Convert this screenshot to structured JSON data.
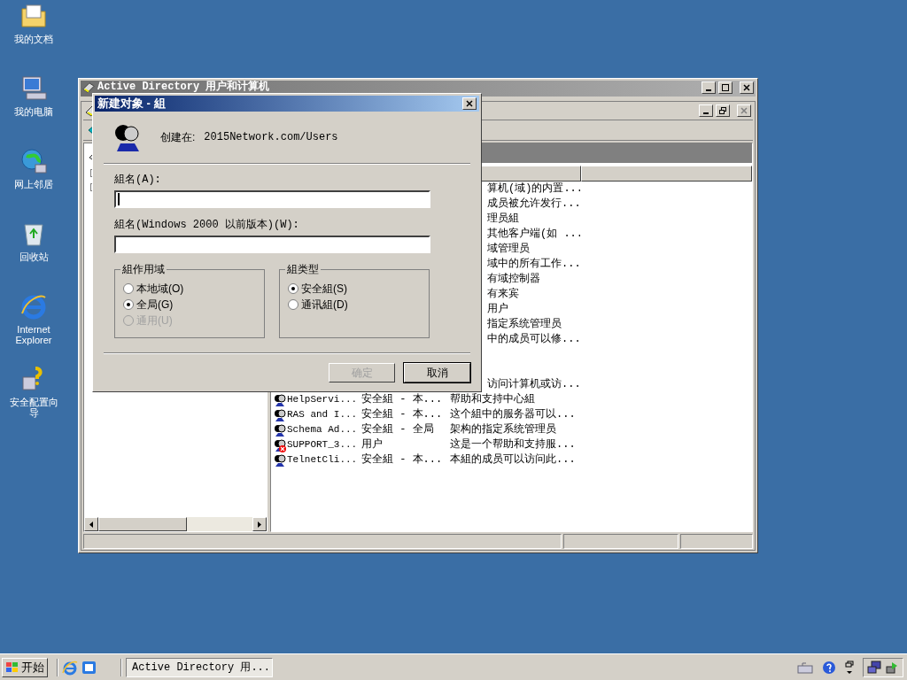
{
  "desktop_icons": [
    {
      "label": "我的文档",
      "kind": "folder"
    },
    {
      "label": "我的电脑",
      "kind": "computer"
    },
    {
      "label": "网上邻居",
      "kind": "network"
    },
    {
      "label": "回收站",
      "kind": "recycle"
    },
    {
      "label": "Internet Explorer",
      "kind": "ie"
    },
    {
      "label": "安全配置向导",
      "kind": "wizard"
    }
  ],
  "main_window": {
    "title": "Active Directory 用户和计算机",
    "list": {
      "rows": [
        {
          "kind": "covered",
          "description": "算机(域)的内置..."
        },
        {
          "kind": "covered",
          "description": "成员被允许发行..."
        },
        {
          "kind": "covered",
          "description": "理员組"
        },
        {
          "kind": "covered",
          "description": "其他客户端(如 ..."
        },
        {
          "kind": "covered",
          "description": "域管理员"
        },
        {
          "kind": "covered",
          "description": "域中的所有工作..."
        },
        {
          "kind": "covered",
          "description": "有域控制器"
        },
        {
          "kind": "covered",
          "description": "有来宾"
        },
        {
          "kind": "covered",
          "description": "用户"
        },
        {
          "kind": "covered",
          "description": "指定系统管理员"
        },
        {
          "kind": "covered",
          "description": "中的成员可以修..."
        },
        {
          "kind": "covered"
        },
        {
          "kind": "covered"
        },
        {
          "kind": "covered",
          "description": "访问计算机或访..."
        },
        {
          "kind": "group",
          "name": "HelpServi...",
          "type": "安全組 - 本...",
          "description": "帮助和支持中心組"
        },
        {
          "kind": "group",
          "name": "RAS and I...",
          "type": "安全組 - 本...",
          "description": "这个組中的服务器可以..."
        },
        {
          "kind": "group",
          "name": "Schema Ad...",
          "type": "安全組 - 全局",
          "description": "架构的指定系统管理员"
        },
        {
          "kind": "user_disabled",
          "name": "SUPPORT_3...",
          "type": "用户",
          "description": "这是一个帮助和支持服..."
        },
        {
          "kind": "group",
          "name": "TelnetCli...",
          "type": "安全組 - 本...",
          "description": "本組的成员可以访问此..."
        }
      ]
    }
  },
  "dialog": {
    "title": "新建对象 - 組",
    "created_in_label": "创建在:",
    "created_in_value": "2015Network.com/Users",
    "fields": [
      {
        "label": "組名(A):",
        "focused": true
      },
      {
        "label": "組名(Windows 2000 以前版本)(W):",
        "focused": false
      }
    ],
    "scope": {
      "title": "組作用域",
      "options": [
        {
          "label": "本地域(O)",
          "selected": false,
          "disabled": false
        },
        {
          "label": "全局(G)",
          "selected": true,
          "disabled": false
        },
        {
          "label": "通用(U)",
          "selected": false,
          "disabled": true
        }
      ]
    },
    "type": {
      "title": "組类型",
      "options": [
        {
          "label": "安全組(S)",
          "selected": true,
          "disabled": false
        },
        {
          "label": "通讯組(D)",
          "selected": false,
          "disabled": false
        }
      ]
    },
    "buttons": [
      {
        "label": "确定",
        "disabled": true,
        "default": false
      },
      {
        "label": "取消",
        "disabled": false,
        "default": true
      }
    ]
  },
  "taskbar": {
    "start": "开始",
    "tasks": [
      {
        "label": "Active Directory 用...",
        "selected": true
      }
    ]
  }
}
